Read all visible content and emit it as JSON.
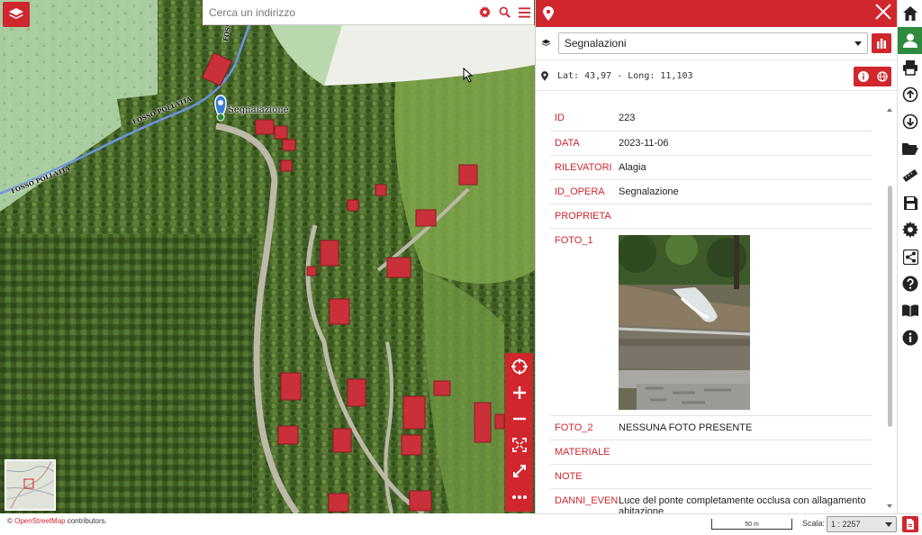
{
  "search": {
    "placeholder": "Cerca un indirizzo"
  },
  "map": {
    "marker_label": "Segnalazione",
    "road_labels": [
      "FOSSO POLLATIA",
      "FOSSO POLLATIA",
      "FOSSO POLLATIA"
    ],
    "attribution_prefix": "© ",
    "attribution_link": "OpenStreetMap",
    "attribution_suffix": " contributors."
  },
  "panel": {
    "layer_selected": "Segnalazioni",
    "coordinates": "Lat: 43,97 - Long: 11,103",
    "attributes": [
      {
        "key": "ID",
        "value": "223"
      },
      {
        "key": "DATA",
        "value": "2023-11-06"
      },
      {
        "key": "RILEVATORI",
        "value": "Alagia"
      },
      {
        "key": "ID_OPERA",
        "value": "Segnalazione"
      },
      {
        "key": "PROPRIETA",
        "value": ""
      },
      {
        "key": "FOTO_1",
        "value": ""
      },
      {
        "key": "FOTO_2",
        "value": "NESSUNA FOTO PRESENTE"
      },
      {
        "key": "MATERIALE",
        "value": ""
      },
      {
        "key": "NOTE",
        "value": ""
      },
      {
        "key": "DANNI_EVEN",
        "value": "Luce del ponte completamente occlusa con allagamento abitazione"
      }
    ]
  },
  "status": {
    "scale_bar_label": "50 m",
    "scala_label": "Scala:",
    "scala_value": "1 : 2257"
  },
  "colors": {
    "accent": "#d0262e",
    "active_green": "#2e8b3e"
  }
}
